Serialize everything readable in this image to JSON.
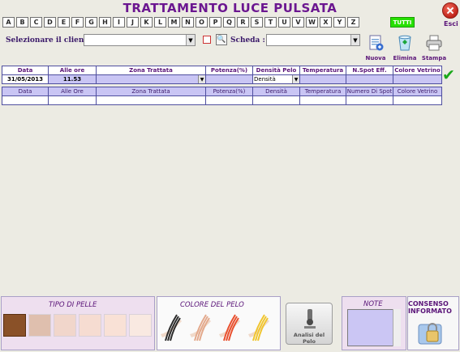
{
  "title": "TRATTAMENTO LUCE PULSATA",
  "esci_label": "Esci",
  "letters": [
    "A",
    "B",
    "C",
    "D",
    "E",
    "F",
    "G",
    "H",
    "I",
    "J",
    "K",
    "L",
    "M",
    "N",
    "O",
    "P",
    "Q",
    "R",
    "S",
    "T",
    "U",
    "V",
    "W",
    "X",
    "Y",
    "Z"
  ],
  "tutti_label": "TUTTI",
  "client": {
    "label": "Selezionare il cliente:",
    "value": ""
  },
  "scheda": {
    "label": "Scheda :",
    "value": ""
  },
  "toolbar": {
    "nuova": "Nuova",
    "elimina": "Elimina",
    "stampa": "Stampa"
  },
  "table": {
    "headers": [
      "Data",
      "Alle ore",
      "Zona Trattata",
      "Potenza(%)",
      "Densità Pelo",
      "Temperatura",
      "N.Spot Eff.",
      "Colore Vetrino"
    ],
    "input_row": {
      "data": "31/05/2013",
      "ora": "11.53",
      "zona": "",
      "potenza": "",
      "densita": "Densità",
      "temperatura": "",
      "spot": "",
      "colore": ""
    },
    "list_headers": [
      "Data",
      "Alle Ore",
      "Zona Trattata",
      "Potenza(%)",
      "Densità",
      "Temperatura",
      "Numero Di Spot",
      "Colore Vetrino"
    ]
  },
  "bottom": {
    "tipo_pelle": "TIPO DI PELLE",
    "colore_pelo": "COLORE DEL PELO",
    "analisi": "Analisi del Pelo",
    "note": "NOTE",
    "consenso": "CONSENSO INFORMATO"
  },
  "skin_tones": [
    "#8a5128",
    "#dfbfae",
    "#f1d6cb",
    "#f6dcd1",
    "#f9e1d6",
    "#f9e9e1"
  ],
  "hair_colors": [
    "#2a2a2a",
    "#e3a98c",
    "#e94f2d",
    "#f0c52e"
  ],
  "colors": {
    "accent": "#6b1690",
    "grid_fill": "#c9c5f4",
    "tutti": "#27e000"
  }
}
